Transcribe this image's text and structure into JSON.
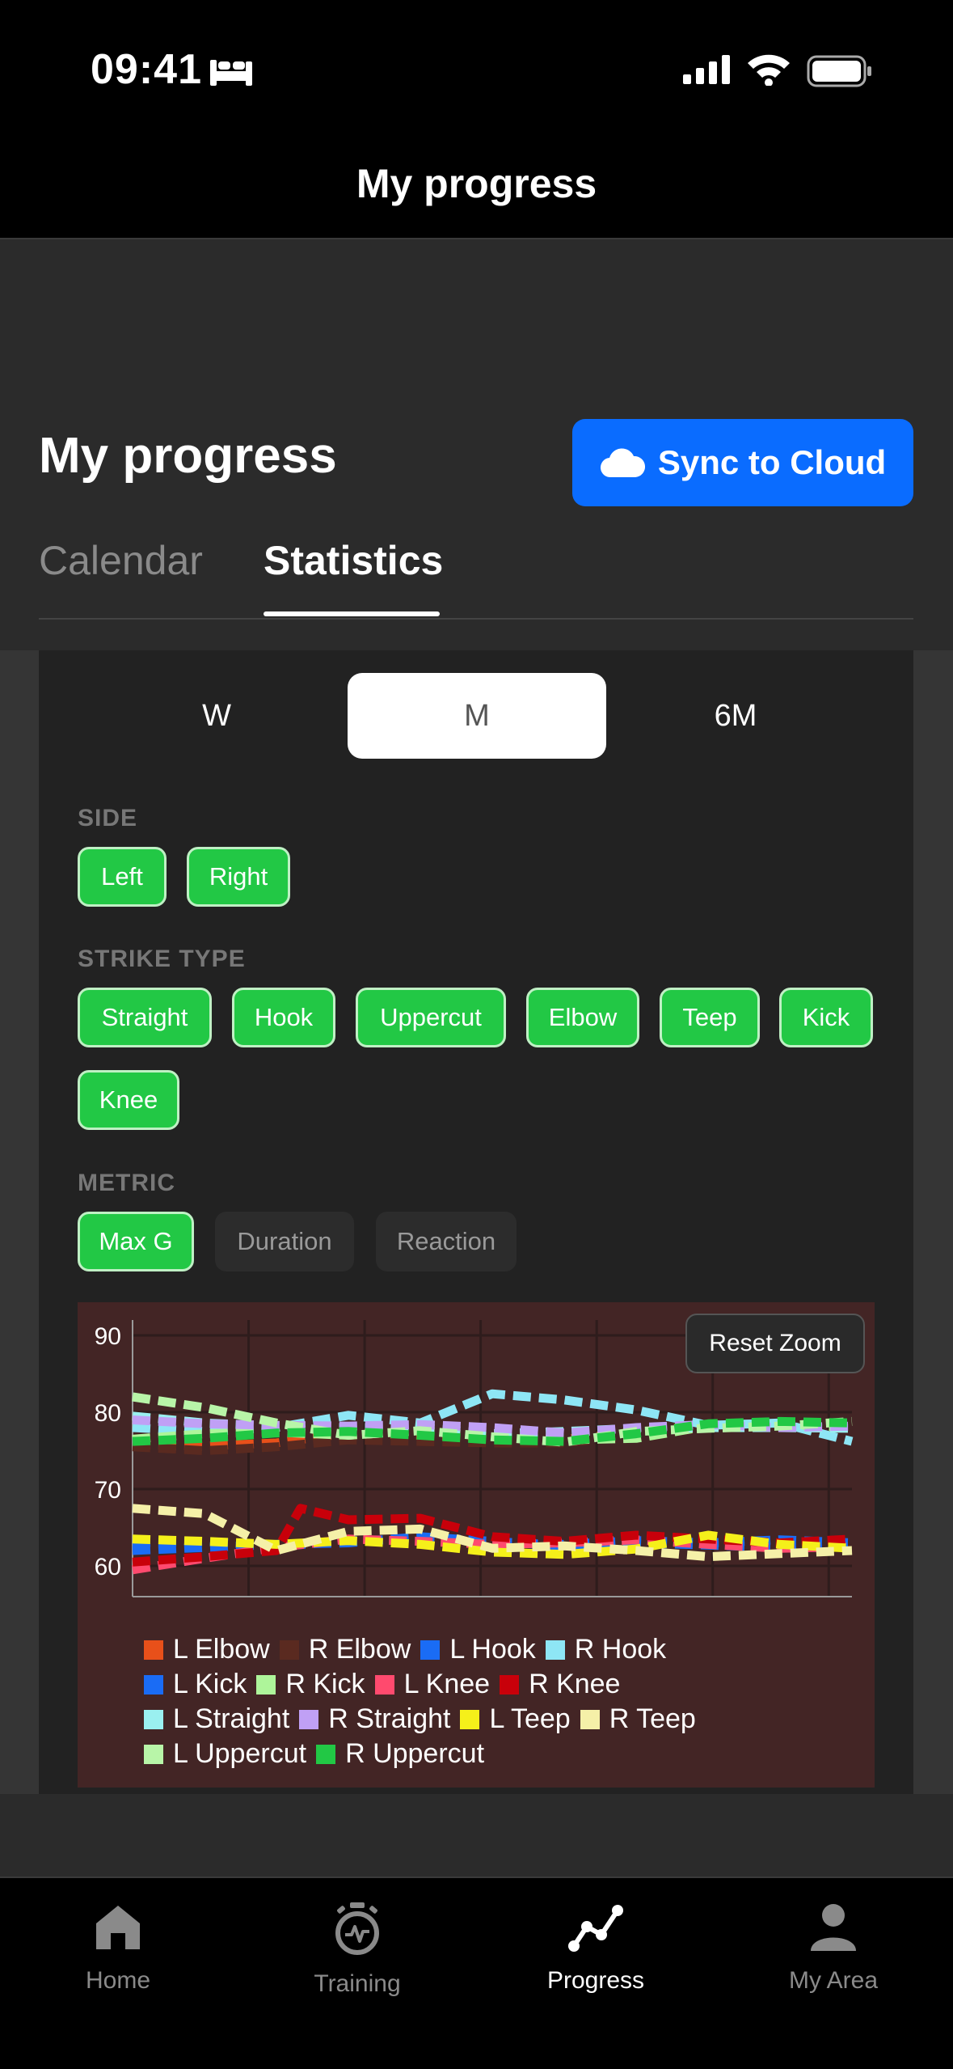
{
  "status_bar": {
    "time": "09:41"
  },
  "nav": {
    "title": "My progress"
  },
  "header": {
    "title": "My progress",
    "sync_label": "Sync to Cloud"
  },
  "tabs": [
    {
      "label": "Calendar",
      "active": false
    },
    {
      "label": "Statistics",
      "active": true
    }
  ],
  "period": {
    "options": [
      "W",
      "M",
      "6M"
    ],
    "selected": "M"
  },
  "filters": {
    "side": {
      "label": "SIDE",
      "chips": [
        "Left",
        "Right"
      ]
    },
    "strike_type": {
      "label": "STRIKE TYPE",
      "chips": [
        "Straight",
        "Hook",
        "Uppercut",
        "Elbow",
        "Teep",
        "Kick",
        "Knee"
      ]
    },
    "metric": {
      "label": "METRIC",
      "chips": [
        "Max G",
        "Duration",
        "Reaction"
      ],
      "selected": "Max G"
    }
  },
  "chart": {
    "reset_zoom_label": "Reset Zoom"
  },
  "chart_data": {
    "type": "line",
    "y_ticks": [
      "90",
      "80",
      "70",
      "60"
    ],
    "ylim": [
      56,
      92
    ],
    "xlim": [
      0,
      30
    ],
    "grid": true,
    "legend_position": "bottom",
    "series": [
      {
        "name": "L Elbow",
        "color": "#e8501a",
        "values": [
          [
            0,
            75.8
          ],
          [
            3,
            75.6
          ],
          [
            6,
            76.0
          ],
          [
            9,
            77.3
          ],
          [
            12,
            77.0
          ],
          [
            15,
            76.8
          ],
          [
            18,
            76.5
          ],
          [
            21,
            77.4
          ],
          [
            24,
            78.4
          ],
          [
            27,
            78.2
          ],
          [
            30,
            78.6
          ]
        ]
      },
      {
        "name": "R Elbow",
        "color": "#5a2a20",
        "values": [
          [
            0,
            75.5
          ],
          [
            3,
            75.0
          ],
          [
            6,
            75.5
          ],
          [
            9,
            76.4
          ],
          [
            12,
            76.2
          ],
          [
            15,
            76.0
          ],
          [
            18,
            76.0
          ],
          [
            21,
            77.0
          ],
          [
            24,
            78.0
          ],
          [
            27,
            78.4
          ],
          [
            30,
            78.0
          ]
        ]
      },
      {
        "name": "L Hook",
        "color": "#1a6cf5",
        "values": [
          [
            0,
            63.0
          ],
          [
            3,
            63.2
          ],
          [
            6,
            62.5
          ],
          [
            9,
            63.3
          ],
          [
            12,
            63.5
          ],
          [
            15,
            63.0
          ],
          [
            18,
            62.8
          ],
          [
            21,
            63.3
          ],
          [
            24,
            63.0
          ],
          [
            27,
            63.4
          ],
          [
            30,
            63.0
          ]
        ]
      },
      {
        "name": "R Hook",
        "color": "#8ee6f5",
        "values": [
          [
            0,
            78.0
          ],
          [
            3,
            77.5
          ],
          [
            6,
            78.0
          ],
          [
            9,
            79.6
          ],
          [
            12,
            78.6
          ],
          [
            15,
            82.4
          ],
          [
            18,
            81.6
          ],
          [
            21,
            80.3
          ],
          [
            24,
            78.3
          ],
          [
            27,
            78.6
          ],
          [
            30,
            76.2
          ]
        ]
      },
      {
        "name": "L Kick",
        "color": "#1a6cf5",
        "values": [
          [
            0,
            62.0
          ],
          [
            3,
            62.4
          ],
          [
            6,
            62.8
          ],
          [
            9,
            63.0
          ],
          [
            12,
            63.8
          ],
          [
            15,
            63.2
          ],
          [
            18,
            62.6
          ],
          [
            21,
            63.0
          ],
          [
            24,
            62.7
          ],
          [
            27,
            62.4
          ],
          [
            30,
            62.9
          ]
        ]
      },
      {
        "name": "R Kick",
        "color": "#aef59a",
        "values": [
          [
            0,
            76.5
          ],
          [
            3,
            77.2
          ],
          [
            6,
            77.4
          ],
          [
            9,
            77.0
          ],
          [
            12,
            77.6
          ],
          [
            15,
            76.8
          ],
          [
            18,
            76.4
          ],
          [
            21,
            76.6
          ],
          [
            24,
            78.2
          ],
          [
            27,
            78.4
          ],
          [
            30,
            78.0
          ]
        ]
      },
      {
        "name": "L Knee",
        "color": "#ff4a6e",
        "values": [
          [
            0,
            59.5
          ],
          [
            3,
            61.0
          ],
          [
            6,
            62.4
          ],
          [
            9,
            63.5
          ],
          [
            12,
            63.2
          ],
          [
            15,
            62.8
          ],
          [
            18,
            63.0
          ],
          [
            21,
            63.4
          ],
          [
            24,
            62.8
          ],
          [
            27,
            62.3
          ],
          [
            30,
            62.5
          ]
        ]
      },
      {
        "name": "R Knee",
        "color": "#c8000a",
        "values": [
          [
            0,
            60.5
          ],
          [
            3,
            61.2
          ],
          [
            6,
            62.0
          ],
          [
            7,
            67.5
          ],
          [
            9,
            66.0
          ],
          [
            12,
            66.2
          ],
          [
            15,
            63.8
          ],
          [
            18,
            63.2
          ],
          [
            21,
            64.0
          ],
          [
            24,
            63.5
          ],
          [
            27,
            63.0
          ],
          [
            30,
            63.5
          ]
        ]
      },
      {
        "name": "L Straight",
        "color": "#9af0f0",
        "values": [
          [
            0,
            79.5
          ],
          [
            3,
            78.6
          ],
          [
            6,
            78.2
          ],
          [
            9,
            78.0
          ],
          [
            12,
            78.0
          ],
          [
            15,
            77.2
          ],
          [
            18,
            77.5
          ],
          [
            21,
            77.9
          ],
          [
            24,
            78.0
          ],
          [
            27,
            78.0
          ],
          [
            30,
            77.9
          ]
        ]
      },
      {
        "name": "R Straight",
        "color": "#c0a0f5",
        "values": [
          [
            0,
            79.0
          ],
          [
            3,
            78.5
          ],
          [
            6,
            78.3
          ],
          [
            9,
            78.2
          ],
          [
            12,
            78.4
          ],
          [
            15,
            78.0
          ],
          [
            18,
            77.3
          ],
          [
            21,
            78.0
          ],
          [
            24,
            78.4
          ],
          [
            27,
            78.0
          ],
          [
            30,
            78.2
          ]
        ]
      },
      {
        "name": "L Teep",
        "color": "#f5f01a",
        "values": [
          [
            0,
            63.5
          ],
          [
            3,
            63.2
          ],
          [
            6,
            62.8
          ],
          [
            9,
            63.3
          ],
          [
            12,
            62.8
          ],
          [
            15,
            61.8
          ],
          [
            18,
            61.5
          ],
          [
            21,
            62.2
          ],
          [
            24,
            64.0
          ],
          [
            27,
            62.8
          ],
          [
            30,
            62.3
          ]
        ]
      },
      {
        "name": "R Teep",
        "color": "#f5f0a8",
        "values": [
          [
            0,
            67.5
          ],
          [
            3,
            66.8
          ],
          [
            6,
            62.0
          ],
          [
            9,
            64.5
          ],
          [
            12,
            64.8
          ],
          [
            15,
            62.3
          ],
          [
            18,
            62.6
          ],
          [
            21,
            62.0
          ],
          [
            24,
            61.2
          ],
          [
            27,
            61.6
          ],
          [
            30,
            62.0
          ]
        ]
      },
      {
        "name": "L Uppercut",
        "color": "#b8f5a8",
        "values": [
          [
            0,
            82.0
          ],
          [
            3,
            80.6
          ],
          [
            6,
            78.6
          ],
          [
            9,
            77.0
          ],
          [
            12,
            77.6
          ],
          [
            15,
            76.8
          ],
          [
            18,
            76.1
          ],
          [
            21,
            77.5
          ],
          [
            24,
            77.9
          ],
          [
            27,
            78.2
          ],
          [
            30,
            78.8
          ]
        ]
      },
      {
        "name": "R Uppercut",
        "color": "#22c845",
        "values": [
          [
            0,
            76.2
          ],
          [
            3,
            76.6
          ],
          [
            6,
            77.3
          ],
          [
            9,
            77.5
          ],
          [
            12,
            77.0
          ],
          [
            15,
            76.4
          ],
          [
            18,
            76.2
          ],
          [
            21,
            77.2
          ],
          [
            24,
            78.5
          ],
          [
            27,
            78.8
          ],
          [
            30,
            78.6
          ]
        ]
      }
    ]
  },
  "tab_bar": [
    {
      "label": "Home",
      "icon": "house-icon",
      "active": false
    },
    {
      "label": "Training",
      "icon": "stopwatch-icon",
      "active": false
    },
    {
      "label": "Progress",
      "icon": "progress-line-icon",
      "active": true
    },
    {
      "label": "My Area",
      "icon": "person-icon",
      "active": false
    }
  ]
}
